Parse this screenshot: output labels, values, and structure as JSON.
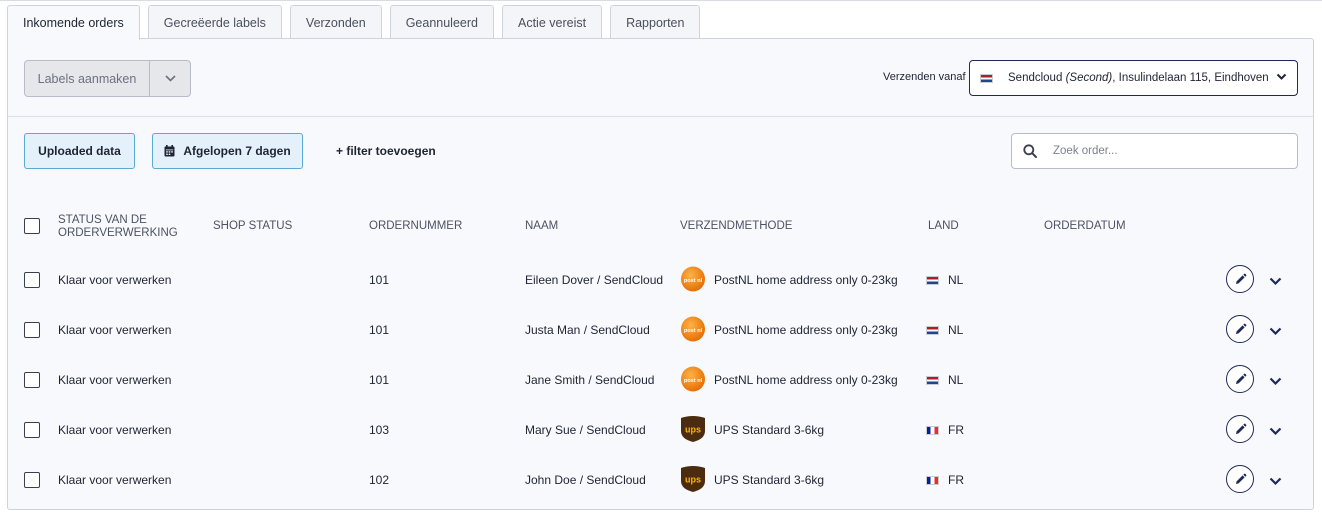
{
  "tabs": [
    {
      "label": "Inkomende orders",
      "active": true
    },
    {
      "label": "Gecreëerde labels",
      "active": false
    },
    {
      "label": "Verzonden",
      "active": false
    },
    {
      "label": "Geannuleerd",
      "active": false
    },
    {
      "label": "Actie vereist",
      "active": false
    },
    {
      "label": "Rapporten",
      "active": false
    }
  ],
  "toolbar": {
    "create_labels_label": "Labels aanmaken",
    "ship_from_label": "Verzenden vanaf",
    "ship_from_company": "Sendcloud",
    "ship_from_tag": "(Second)",
    "ship_from_address": ", Insulindelaan 115, Eindhoven"
  },
  "filters": {
    "uploaded_data_label": "Uploaded data",
    "date_range_label": "Afgelopen 7 dagen",
    "add_filter_label": "+ filter toevoegen",
    "search_placeholder": "Zoek order..."
  },
  "table": {
    "headers": {
      "status": "STATUS VAN DE ORDERVERWERKING",
      "shop_status": "SHOP STATUS",
      "order_number": "ORDERNUMMER",
      "name": "NAAM",
      "shipping_method": "VERZENDMETHODE",
      "country": "LAND",
      "order_date": "ORDERDATUM"
    },
    "rows": [
      {
        "status": "Klaar voor verwerken",
        "shop_status": "",
        "order_number": "101",
        "name": "Eileen Dover / SendCloud",
        "carrier": "postnl",
        "carrier_logo_text": "post nl",
        "shipping_method": "PostNL home address only 0-23kg",
        "flag": "nl",
        "country": "NL",
        "order_date": ""
      },
      {
        "status": "Klaar voor verwerken",
        "shop_status": "",
        "order_number": "101",
        "name": "Justa Man / SendCloud",
        "carrier": "postnl",
        "carrier_logo_text": "post nl",
        "shipping_method": "PostNL home address only 0-23kg",
        "flag": "nl",
        "country": "NL",
        "order_date": ""
      },
      {
        "status": "Klaar voor verwerken",
        "shop_status": "",
        "order_number": "101",
        "name": "Jane Smith / SendCloud",
        "carrier": "postnl",
        "carrier_logo_text": "post nl",
        "shipping_method": "PostNL home address only 0-23kg",
        "flag": "nl",
        "country": "NL",
        "order_date": ""
      },
      {
        "status": "Klaar voor verwerken",
        "shop_status": "",
        "order_number": "103",
        "name": "Mary Sue / SendCloud",
        "carrier": "ups",
        "carrier_logo_text": "ups",
        "shipping_method": "UPS Standard 3-6kg",
        "flag": "fr",
        "country": "FR",
        "order_date": ""
      },
      {
        "status": "Klaar voor verwerken",
        "shop_status": "",
        "order_number": "102",
        "name": "John Doe / SendCloud",
        "carrier": "ups",
        "carrier_logo_text": "ups",
        "shipping_method": "UPS Standard 3-6kg",
        "flag": "fr",
        "country": "FR",
        "order_date": ""
      }
    ]
  },
  "colors": {
    "accent": "#1f2a5a",
    "chip_background": "#e4f1fa",
    "chip_border": "#5aa9d6",
    "postnl_orange": "#f07d00",
    "ups_brown": "#4b2c10",
    "ups_gold": "#ffb500"
  },
  "icons": {
    "ship_from_flag": "flag-nl-icon",
    "calendar": "calendar-icon",
    "search": "search-icon",
    "edit": "pencil-icon",
    "expand": "chevron-down-icon"
  }
}
